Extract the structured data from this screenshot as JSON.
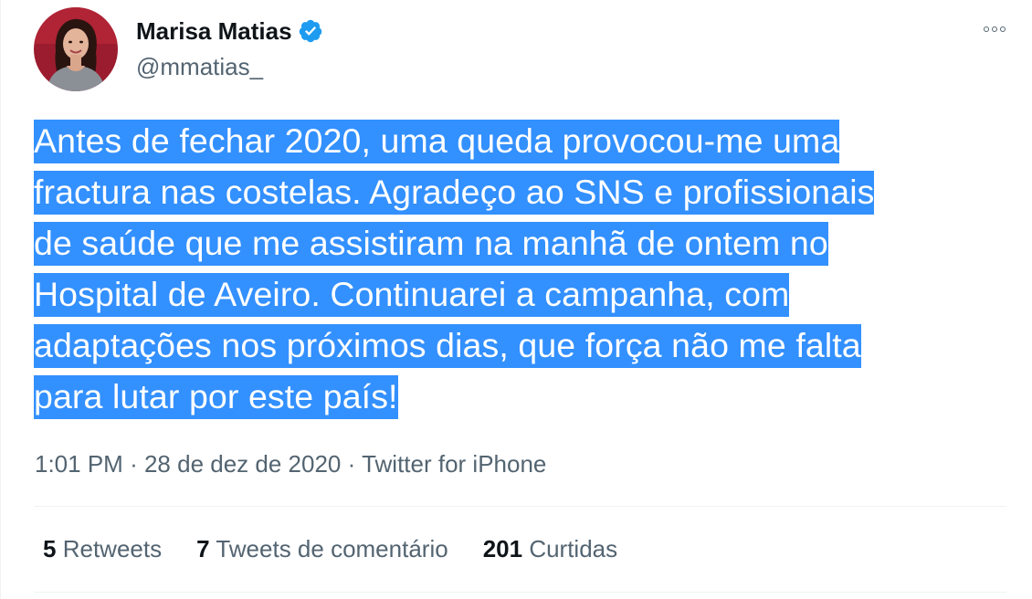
{
  "author": {
    "display_name": "Marisa Matias",
    "handle": "@mmatias_",
    "verified": true,
    "avatar_icon": "profile-photo"
  },
  "tweet": {
    "lines": [
      "Antes de fechar 2020, uma queda provocou-me uma",
      "fractura nas costelas. Agradeço ao SNS e profissionais",
      "de saúde que me assistiram na manhã de ontem no",
      "Hospital de Aveiro. Continuarei a campanha, com",
      "adaptações nos próximos dias, que força não me falta",
      "para lutar por este país!"
    ],
    "selected": true
  },
  "meta": {
    "time": "1:01 PM",
    "date": "28 de dez de 2020",
    "source": "Twitter for iPhone",
    "separator": "·"
  },
  "stats": {
    "retweets_count": "5",
    "retweets_label": "Retweets",
    "comments_count": "7",
    "comments_label": "Tweets de comentário",
    "likes_count": "201",
    "likes_label": "Curtidas"
  },
  "colors": {
    "selection": "#3390ff",
    "verified_badge": "#1d9bf0",
    "secondary_text": "#536471",
    "primary_text": "#0f1419"
  }
}
